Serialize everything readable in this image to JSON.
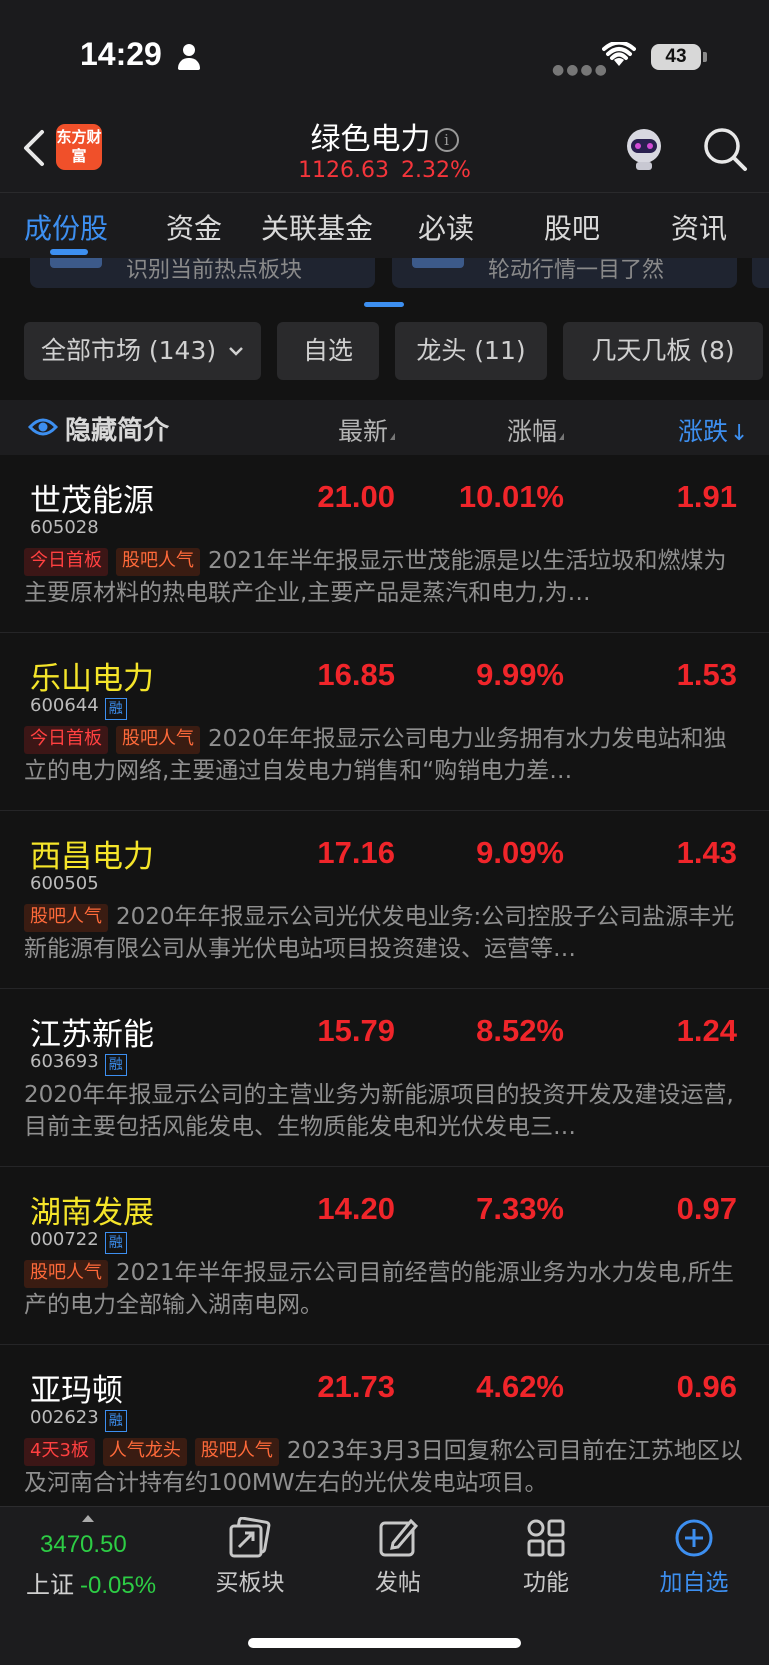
{
  "status_bar": {
    "time": "14:29",
    "battery": "43"
  },
  "header": {
    "logo_text": "东方财富",
    "title": "绿色电力",
    "index_value": "1126.63",
    "index_change": "2.32%"
  },
  "tabs": [
    "成份股",
    "资金",
    "关联基金",
    "必读",
    "股吧",
    "资讯"
  ],
  "banner": [
    "识别当前热点板块",
    "轮动行情一目了然"
  ],
  "filters": [
    "全部市场 (143)",
    "自选",
    "龙头 (11)",
    "几天几板 (8)"
  ],
  "list_header": {
    "toggle": "隐藏简介",
    "col_latest": "最新",
    "col_pct": "涨幅",
    "col_change": "涨跌"
  },
  "stocks": [
    {
      "name": "世茂能源",
      "code": "605028",
      "rong": "",
      "price": "21.00",
      "pct": "10.01%",
      "change": "1.91",
      "tags": [
        "今日首板",
        "股吧人气"
      ],
      "desc": "2021年半年报显示世茂能源是以生活垃圾和燃煤为主要原材料的热电联产企业,主要产品是蒸汽和电力,为…"
    },
    {
      "name": "乐山电力",
      "code": "600644",
      "rong": "融",
      "price": "16.85",
      "pct": "9.99%",
      "change": "1.53",
      "tags": [
        "今日首板",
        "股吧人气"
      ],
      "desc": "2020年年报显示公司电力业务拥有水力发电站和独立的电力网络,主要通过自发电力销售和“购销电力差…"
    },
    {
      "name": "西昌电力",
      "code": "600505",
      "rong": "",
      "price": "17.16",
      "pct": "9.09%",
      "change": "1.43",
      "tags": [
        "股吧人气"
      ],
      "desc": "2020年年报显示公司光伏发电业务:公司控股子公司盐源丰光新能源有限公司从事光伏电站项目投资建设、运营等…"
    },
    {
      "name": "江苏新能",
      "code": "603693",
      "rong": "融",
      "price": "15.79",
      "pct": "8.52%",
      "change": "1.24",
      "tags": [],
      "desc": "2020年年报显示公司的主营业务为新能源项目的投资开发及建设运营,目前主要包括风能发电、生物质能发电和光伏发电三…"
    },
    {
      "name": "湖南发展",
      "code": "000722",
      "rong": "融",
      "price": "14.20",
      "pct": "7.33%",
      "change": "0.97",
      "tags": [
        "股吧人气"
      ],
      "desc": "2021年半年报显示公司目前经营的能源业务为水力发电,所生产的电力全部输入湖南电网。"
    },
    {
      "name": "亚玛顿",
      "code": "002623",
      "rong": "融",
      "price": "21.73",
      "pct": "4.62%",
      "change": "0.96",
      "tags": [
        "4天3板",
        "人气龙头",
        "股吧人气"
      ],
      "desc": "2023年3月3日回复称公司目前在江苏地区以及河南合计持有约100MW左右的光伏发电站项目。"
    }
  ],
  "bottom_nav": {
    "index_value": "3470.50",
    "index_name": "上证",
    "index_pct": "-0.05%",
    "items": [
      "买板块",
      "发帖",
      "功能",
      "加自选"
    ]
  },
  "colors": {
    "accent": "#3d8ff0",
    "up": "#f0252a",
    "down": "#2dcd45",
    "highlight_name": "#f5e52a"
  }
}
